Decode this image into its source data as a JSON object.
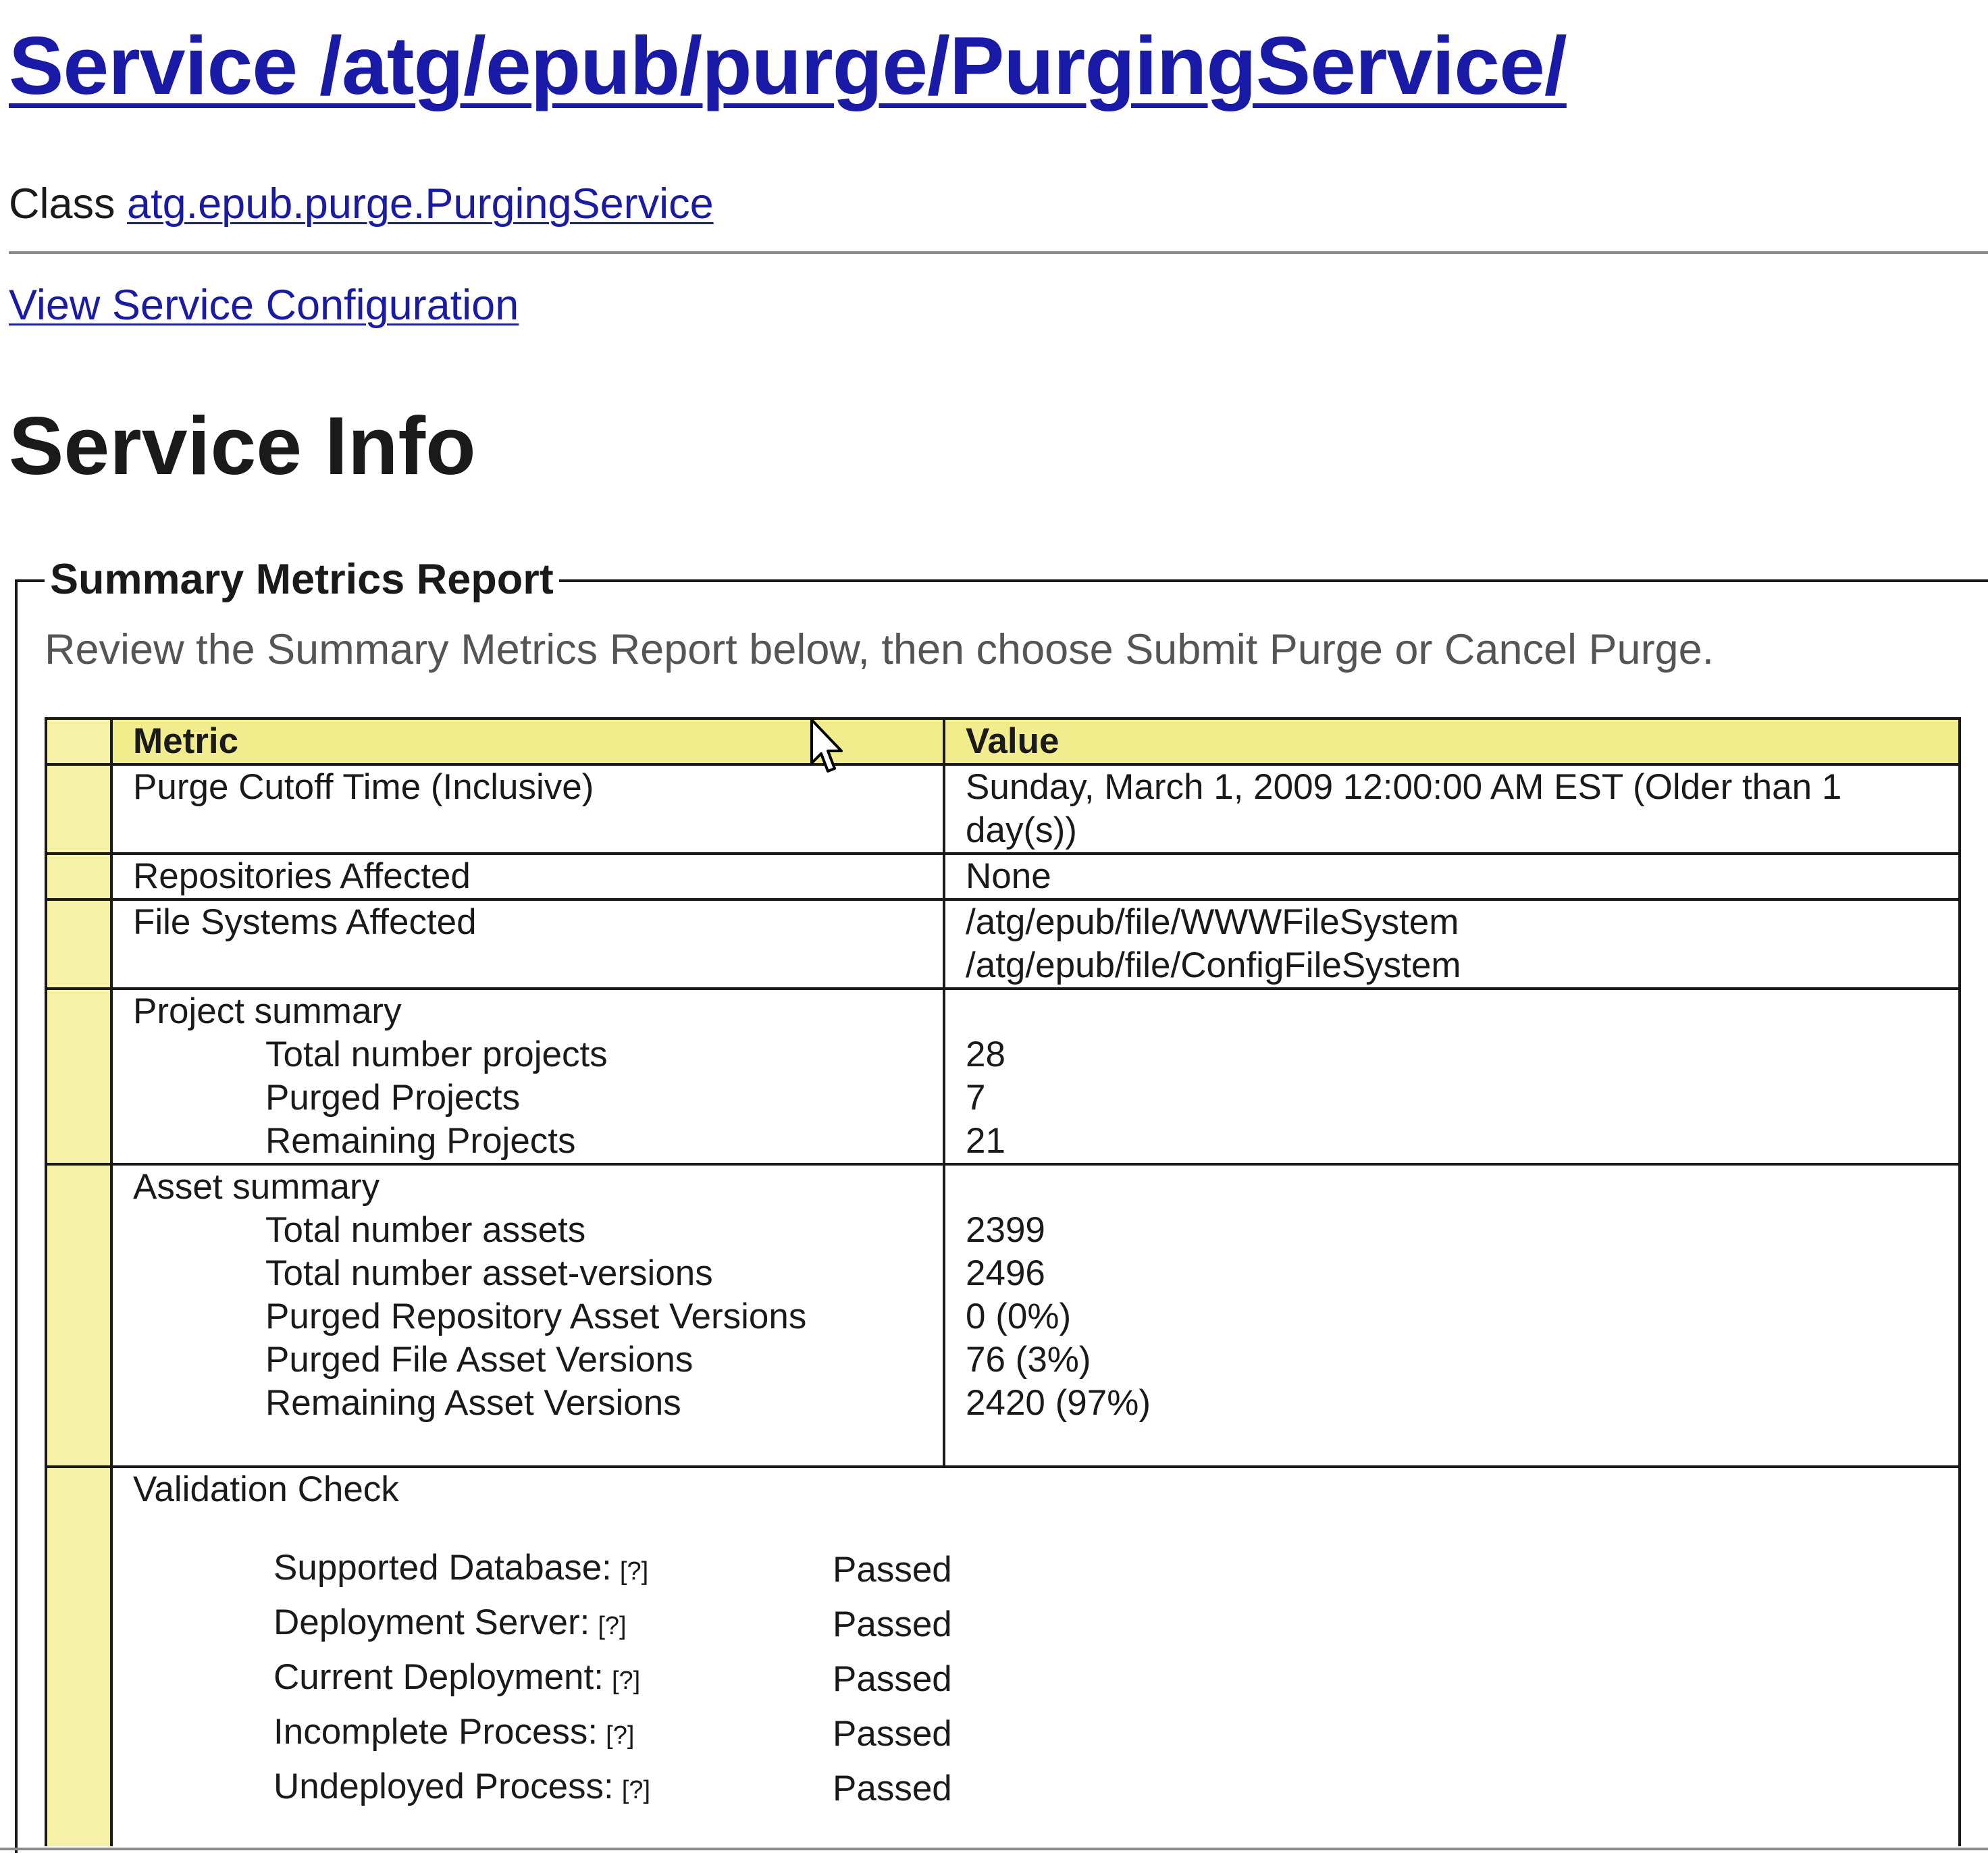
{
  "header": {
    "title": "Service /atg/epub/purge/PurgingService/",
    "class_prefix": "Class",
    "class_name": "atg.epub.purge.PurgingService",
    "config_link": "View Service Configuration"
  },
  "section": {
    "heading": "Service Info"
  },
  "report": {
    "legend": "Summary Metrics Report",
    "instructions": "Review the Summary Metrics Report below, then choose Submit Purge or Cancel Purge.",
    "columns": {
      "metric": "Metric",
      "value": "Value"
    },
    "cutoff": {
      "label": "Purge Cutoff Time (Inclusive)",
      "value_line1": "Sunday, March 1, 2009 12:00:00 AM EST (Older than 1",
      "value_line2": "day(s))"
    },
    "repositories": {
      "label": "Repositories Affected",
      "value": "None"
    },
    "file_systems": {
      "label": "File Systems Affected",
      "values": [
        "/atg/epub/file/WWWFileSystem",
        "/atg/epub/file/ConfigFileSystem"
      ]
    },
    "project_summary": {
      "label": "Project summary",
      "items": [
        {
          "label": "Total number projects",
          "value": "28"
        },
        {
          "label": "Purged Projects",
          "value": "7"
        },
        {
          "label": "Remaining Projects",
          "value": "21"
        }
      ]
    },
    "asset_summary": {
      "label": "Asset summary",
      "items": [
        {
          "label": "Total number assets",
          "value": "2399"
        },
        {
          "label": "Total number asset-versions",
          "value": "2496"
        },
        {
          "label": "Purged Repository Asset Versions",
          "value": "0 (0%)"
        },
        {
          "label": "Purged File Asset Versions",
          "value": "76 (3%)"
        },
        {
          "label": "Remaining Asset Versions",
          "value": "2420 (97%)"
        }
      ]
    },
    "validation": {
      "label": "Validation Check",
      "help_label": "[?]",
      "items": [
        {
          "label": "Supported Database:",
          "status": "Passed"
        },
        {
          "label": "Deployment Server:",
          "status": "Passed"
        },
        {
          "label": "Current Deployment:",
          "status": "Passed"
        },
        {
          "label": "Incomplete Process:",
          "status": "Passed"
        },
        {
          "label": "Undeployed Process:",
          "status": "Passed"
        }
      ]
    }
  },
  "colors": {
    "link": "#1a1aa8",
    "header_fill": "#f2ed8c",
    "marker_fill": "#f5f1a6",
    "instruction_text": "#555555"
  },
  "icons": {
    "cursor": "mouse-pointer-icon"
  }
}
